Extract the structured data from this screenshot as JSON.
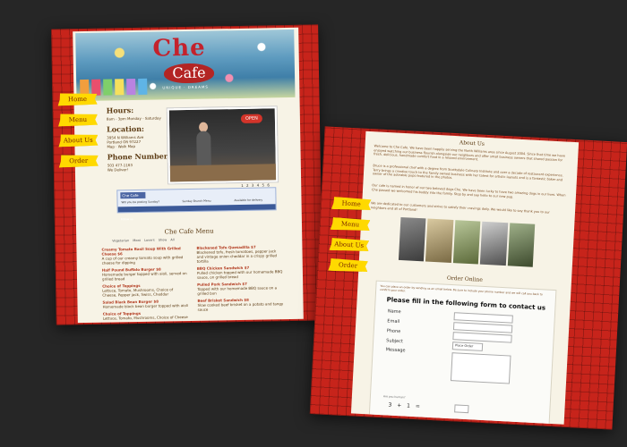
{
  "colors": {
    "background": "#262626",
    "border_red": "#c7241b",
    "content_bg": "#f7f3e6",
    "tab_yellow": "#ffd900",
    "text_brown": "#5b3a12"
  },
  "left_page": {
    "logo": {
      "che": "Che",
      "cafe": "Cafe",
      "tagline": "UNIQUE · DREAMS"
    },
    "nav": [
      "Home",
      "Menu",
      "About Us",
      "Order Online"
    ],
    "hours": {
      "title": "Hours:",
      "text": "8am - 3pm Monday - Saturday",
      "location_title": "Location:",
      "address1": "3954 N Williams Ave",
      "address2": "Portland OR 97227",
      "map_link": "Map · Walk Map",
      "phone_title": "Phone Number:",
      "phone": "503 477-1163",
      "delivery": "We Deliver!"
    },
    "photo": {
      "sign": "OPEN"
    },
    "pager": "1 2 3 4 5 6",
    "facebook": {
      "badge": "Che Cafe",
      "left_text": "Will you be posting Sunday?",
      "mid_text": "Sunday Brunch Menu",
      "right_text": "Available for delivery",
      "bar_label": "Follow us"
    },
    "menu": {
      "title": "Che Cafe Menu",
      "tabs": "Vegetarian   Meat Lovers   Show All",
      "col1": [
        {
          "name": "Creamy Tomato Basil Soup With Grilled Cheese $6",
          "desc": "A cup of our creamy tomato soup with grilled cheese for dipping"
        },
        {
          "name": "Half Pound Buffalo Burger $8",
          "desc": "Homemade burger topped with aioli, served on grilled bread"
        },
        {
          "name": "Choice of Toppings",
          "desc": "Lettuce, Tomato, Mushrooms, Choice of Cheese, Pepper jack, Swiss, Cheddar"
        },
        {
          "name": "Salad Black Bean Burger $8",
          "desc": "Homemade black bean burger topped with aioli"
        },
        {
          "name": "Choice of Toppings",
          "desc": "Lettuce, Tomato, Mushrooms, Choice of Cheese"
        }
      ],
      "col2": [
        {
          "name": "Blackened Tofu Quesadilla $7",
          "desc": "Blackened tofu, fresh tomatoes, pepper jack and vintage onion cheddar in a crispy grilled tortilla"
        },
        {
          "name": "BBQ Chicken Sandwich $7",
          "desc": "Pulled chicken topped with our homemade BBQ sauce, on grilled bread"
        },
        {
          "name": "Pulled Pork Sandwich $7",
          "desc": "Topped with our homemade BBQ sauce on a grilled bun"
        },
        {
          "name": "Beef Brisket Sandwich $8",
          "desc": "Slow cooked beef brisket on a potato and tangy sauce"
        }
      ]
    }
  },
  "right_page": {
    "nav": [
      "Home",
      "Menu",
      "About Us",
      "Order Online"
    ],
    "about": {
      "title": "About Us",
      "p1": "Welcome to Che Cafe. We have been happily serving the North Williams area since August 2004. Since that time we have enjoyed watching our business flourish alongside our neighbors and offer small business owners that shared passion for fresh, delicious, handmade comfort food in a relaxed environment.",
      "p2": "Bruce is a professional chef with a degree from Scottsdale Culinary Institute and over a decade of restaurant experience. Terry brings a creative touch to the family owned business with her talent for artistic layouts and is a fantastic baker and owner of the adorable pups featured in the photos.",
      "p3": "Our cafe is named in honor of our two beloved dogs Che. We have been lucky to have two amazing dogs in our lives. When Che passed we welcomed his buddy into the family. Stop by and say hello to our new pup.",
      "p4": "We are dedicated to our customers and strive to satisfy their cravings daily. We would like to say thank you to our neighbors and all of Portland!"
    },
    "order": {
      "title": "Order Online",
      "hint": "You can place an order by sending us an email below. Be sure to include your phone number and we will call you back to confirm your order.",
      "heading": "Please fill in the following form to contact us",
      "fields": {
        "name": "Name",
        "email": "Email",
        "phone": "Phone",
        "subject": "Subject",
        "message": "Message"
      },
      "subject_value": "Place Order",
      "human": "Are you human?",
      "captcha": "3 + 1 ="
    }
  }
}
